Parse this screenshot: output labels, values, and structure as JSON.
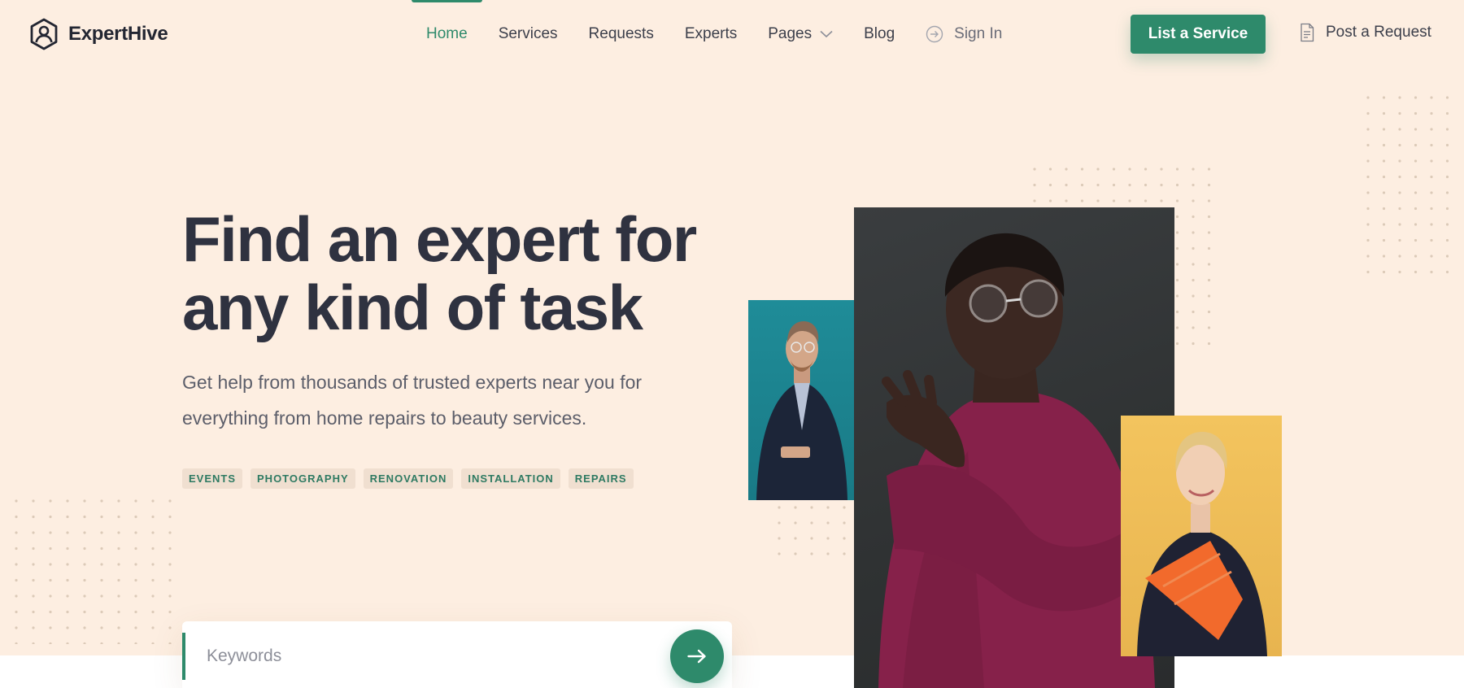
{
  "brand": {
    "name": "ExpertHive"
  },
  "nav": {
    "items": [
      {
        "label": "Home",
        "active": true
      },
      {
        "label": "Services"
      },
      {
        "label": "Requests"
      },
      {
        "label": "Experts"
      },
      {
        "label": "Pages",
        "has_dropdown": true
      },
      {
        "label": "Blog"
      }
    ],
    "signin_label": "Sign In",
    "cta_label": "List a Service",
    "post_request_label": "Post a Request"
  },
  "hero": {
    "headline_line1": "Find an expert for",
    "headline_line2": "any kind of task",
    "subtext_line1": "Get help from thousands of trusted experts near you for",
    "subtext_line2": "everything from home repairs to beauty services.",
    "tags": [
      "EVENTS",
      "PHOTOGRAPHY",
      "RENOVATION",
      "INSTALLATION",
      "REPAIRS"
    ]
  },
  "search": {
    "placeholder": "Keywords"
  },
  "colors": {
    "accent": "#2e8a6b",
    "background": "#fdeee1",
    "heading": "#2f3240",
    "tag_background": "#f0dfd0"
  },
  "icons": [
    "logo-icon",
    "chevron-down-icon",
    "sign-in-icon",
    "document-icon",
    "arrow-right-icon"
  ]
}
